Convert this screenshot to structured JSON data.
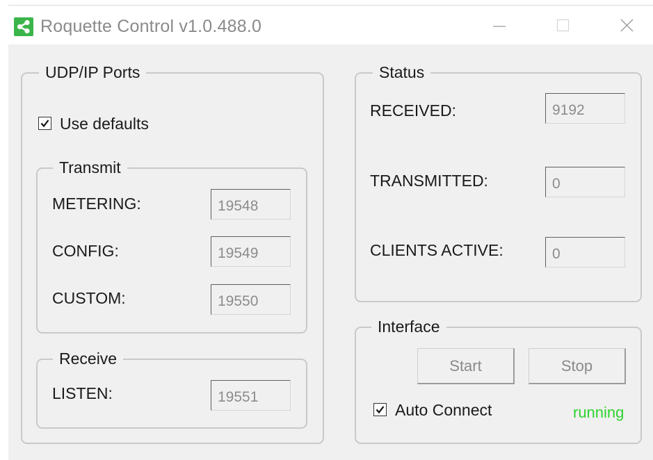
{
  "window": {
    "title": "Roquette Control v1.0.488.0",
    "icon": "share-icon",
    "controls": [
      "minimize-icon",
      "maximize-icon",
      "close-icon"
    ]
  },
  "ports": {
    "group_title": "UDP/IP Ports",
    "use_defaults_label": "Use defaults",
    "use_defaults_checked": true,
    "transmit": {
      "group_title": "Transmit",
      "metering_label": "METERING:",
      "metering_value": "19548",
      "config_label": "CONFIG:",
      "config_value": "19549",
      "custom_label": "CUSTOM:",
      "custom_value": "19550"
    },
    "receive": {
      "group_title": "Receive",
      "listen_label": "LISTEN:",
      "listen_value": "19551"
    }
  },
  "status": {
    "group_title": "Status",
    "received_label": "RECEIVED:",
    "received_value": "9192",
    "transmitted_label": "TRANSMITTED:",
    "transmitted_value": "0",
    "clients_label": "CLIENTS ACTIVE:",
    "clients_value": "0"
  },
  "interface": {
    "group_title": "Interface",
    "start_label": "Start",
    "stop_label": "Stop",
    "auto_connect_label": "Auto Connect",
    "auto_connect_checked": true,
    "state_text": "running",
    "state_color": "#2fd22f"
  }
}
